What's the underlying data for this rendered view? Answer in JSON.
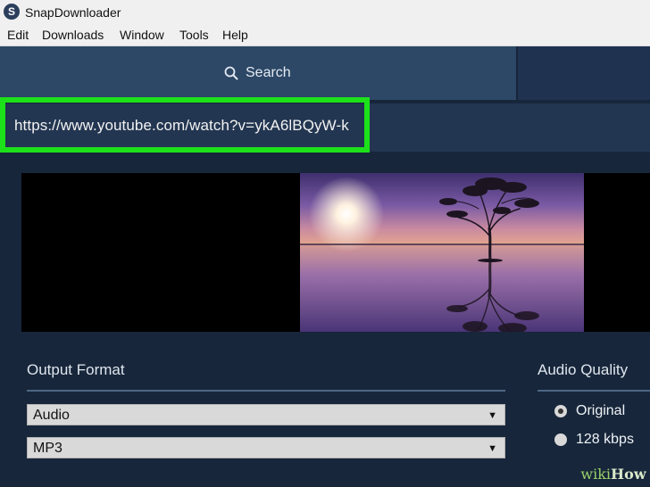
{
  "app": {
    "icon_letter": "S",
    "title": "SnapDownloader"
  },
  "menu": [
    "Edit",
    "Downloads",
    "Window",
    "Tools",
    "Help"
  ],
  "tabs": {
    "search_label": "Search",
    "search_icon": "search-icon"
  },
  "url_field": {
    "value": "https://www.youtube.com/watch?v=ykA6lBQyW-k",
    "highlight_color": "#1ce11a"
  },
  "output_format": {
    "label": "Output Format",
    "type_value": "Audio",
    "codec_value": "MP3"
  },
  "audio_quality": {
    "label": "Audio Quality",
    "options": [
      {
        "label": "Original",
        "selected": true
      },
      {
        "label": "128 kbps",
        "selected": false
      }
    ]
  },
  "watermark": {
    "part1": "wiki",
    "part2": "How"
  },
  "colors": {
    "background": "#17263a",
    "active_tab": "#2d4866",
    "url_bar": "#233651"
  }
}
